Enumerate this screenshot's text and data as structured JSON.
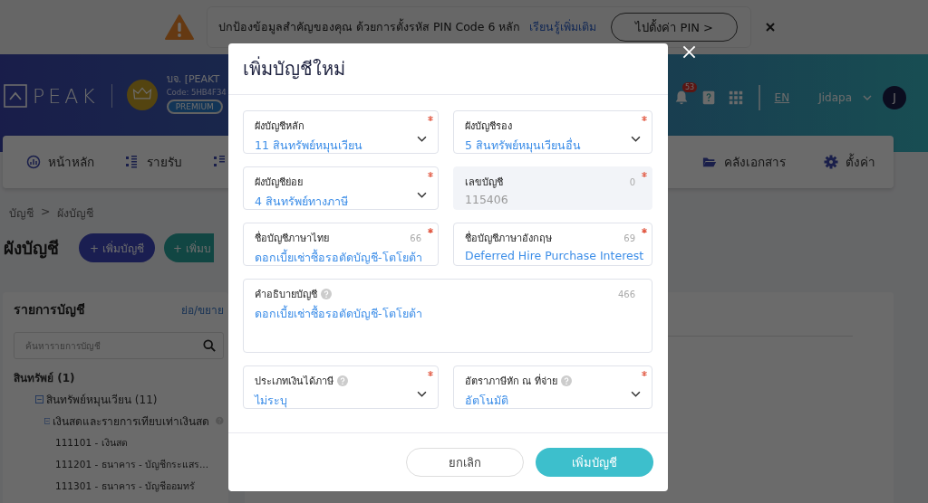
{
  "banner": {
    "message": "ปกป้องข้อมูลสำคัญของคุณ ด้วยการตั้งรหัส PIN Code 6 หลัก",
    "link": "เรียนรู้เพิ่มเติม",
    "button": "ไปตั้งค่า PIN >"
  },
  "header": {
    "logo": "PEAK",
    "company": "บจ. [PEAKT",
    "code": "Code: 5HB4F34",
    "plan_badge": "PREMIUM",
    "notification_count": "53",
    "language": "EN",
    "user": "Jidapa",
    "avatar_initial": "J"
  },
  "nav_left": [
    {
      "label": "หน้าหลัก"
    },
    {
      "label": "รายรับ"
    }
  ],
  "nav_right": [
    {
      "label": "คลังเอกสาร"
    },
    {
      "label": "ตั้งค่า"
    }
  ],
  "breadcrumb": [
    "บัญชี",
    ">",
    "ผังบัญชี"
  ],
  "page_title": "ผังบัญชี",
  "page_buttons": [
    {
      "label": "+ เพิ่มบัญชี",
      "kind": "primary"
    },
    {
      "label": "+ เพิ่มบ",
      "kind": "secondary"
    }
  ],
  "account_list": {
    "title": "รายการบัญชี",
    "toggle": "ย่อ/ขยาย",
    "search_placeholder": "ค้นหารายการบัญชี",
    "tree": [
      {
        "label": "สินทรัพย์ (1)",
        "children": [
          {
            "label": "สินทรัพย์หมุนเวียน (11)",
            "expanded": true,
            "help": false,
            "children": [
              {
                "label": "เงินสดและรายการเทียบเท่าเงินสด",
                "expanded": true,
                "help": true,
                "children": [
                  {
                    "label": "111101 - เงินสด"
                  },
                  {
                    "label": "111201 - ธนาคาร - บัญชีกระแสร..."
                  },
                  {
                    "label": "111301 - ธนาคาร - บัญชีออมทรั"
                  }
                ]
              }
            ]
          }
        ]
      }
    ]
  },
  "modal": {
    "title": "เพิ่มบัญชีใหม่",
    "fields": [
      {
        "kind": "select",
        "label": "ผังบัญชีหลัก",
        "value": "11 สินทรัพย์หมุนเวียน",
        "required": true,
        "help": false
      },
      {
        "kind": "select",
        "label": "ผังบัญชีรอง",
        "value": "5 สินทรัพย์หมุนเวียนอื่น",
        "required": true,
        "help": false
      },
      {
        "kind": "select",
        "label": "ผังบัญชีย่อย",
        "value": "4 สินทรัพย์ทางภาษี",
        "required": true,
        "help": false
      },
      {
        "kind": "readonly",
        "label": "เลขบัญชี",
        "value": "115406",
        "counter": "0",
        "required": true,
        "help": false
      },
      {
        "kind": "text",
        "label": "ชื่อบัญชีภาษาไทย",
        "value": "ดอกเบี้ยเช่าซื้อรอตัดบัญชี-โตโยต้า",
        "counter": "66",
        "required": true,
        "help": false
      },
      {
        "kind": "text",
        "label": "ชื่อบัญชีภาษาอังกฤษ",
        "value": "Deferred Hire Purchase Interest",
        "counter": "69",
        "required": true,
        "help": false
      },
      {
        "kind": "textarea",
        "label": "คำอธิบายบัญชี",
        "value": "ดอกเบี้ยเช่าซื้อรอตัดบัญชี-โตโยต้า",
        "counter": "466",
        "required": false,
        "help": true
      },
      {
        "kind": "select",
        "label": "ประเภทเงินได้ภาษี",
        "value": "ไม่ระบุ",
        "required": true,
        "help": true
      },
      {
        "kind": "select",
        "label": "อัตราภาษีหัก ณ ที่จ่าย",
        "value": "อัตโนมัติ",
        "required": true,
        "help": true
      }
    ],
    "buttons": [
      {
        "label": "ยกเลิก",
        "kind": "cancel"
      },
      {
        "label": "เพิ่มบัญชี",
        "kind": "submit"
      }
    ]
  }
}
